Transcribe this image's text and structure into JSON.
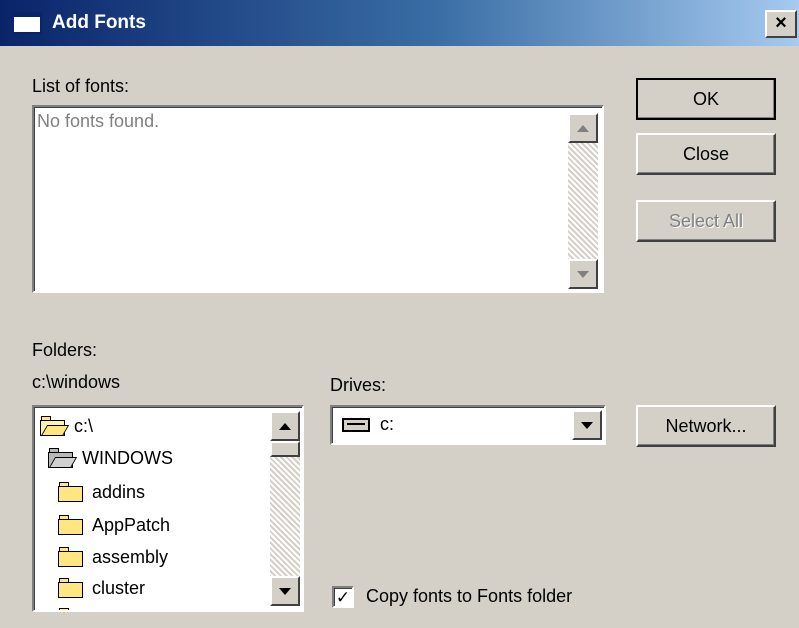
{
  "window": {
    "title": "Add Fonts",
    "close_glyph": "×"
  },
  "fonts_list": {
    "label": "List of fonts:",
    "empty_text": "No fonts found."
  },
  "buttons": {
    "ok": "OK",
    "close": "Close",
    "select_all": "Select All",
    "network": "Network..."
  },
  "folders": {
    "label": "Folders:",
    "current_path": "c:\\windows",
    "items": [
      {
        "name": "c:\\",
        "icon": "open-folder-icon"
      },
      {
        "name": "WINDOWS",
        "icon": "open-folder-icon"
      },
      {
        "name": "addins",
        "icon": "folder-icon"
      },
      {
        "name": "AppPatch",
        "icon": "folder-icon"
      },
      {
        "name": "assembly",
        "icon": "folder-icon"
      },
      {
        "name": "cluster",
        "icon": "folder-icon"
      }
    ]
  },
  "drives": {
    "label": "Drives:",
    "selected": "c:",
    "icon": "drive-icon"
  },
  "copy_option": {
    "label": "Copy fonts to Fonts folder",
    "checked": true,
    "check_glyph": "✓"
  }
}
